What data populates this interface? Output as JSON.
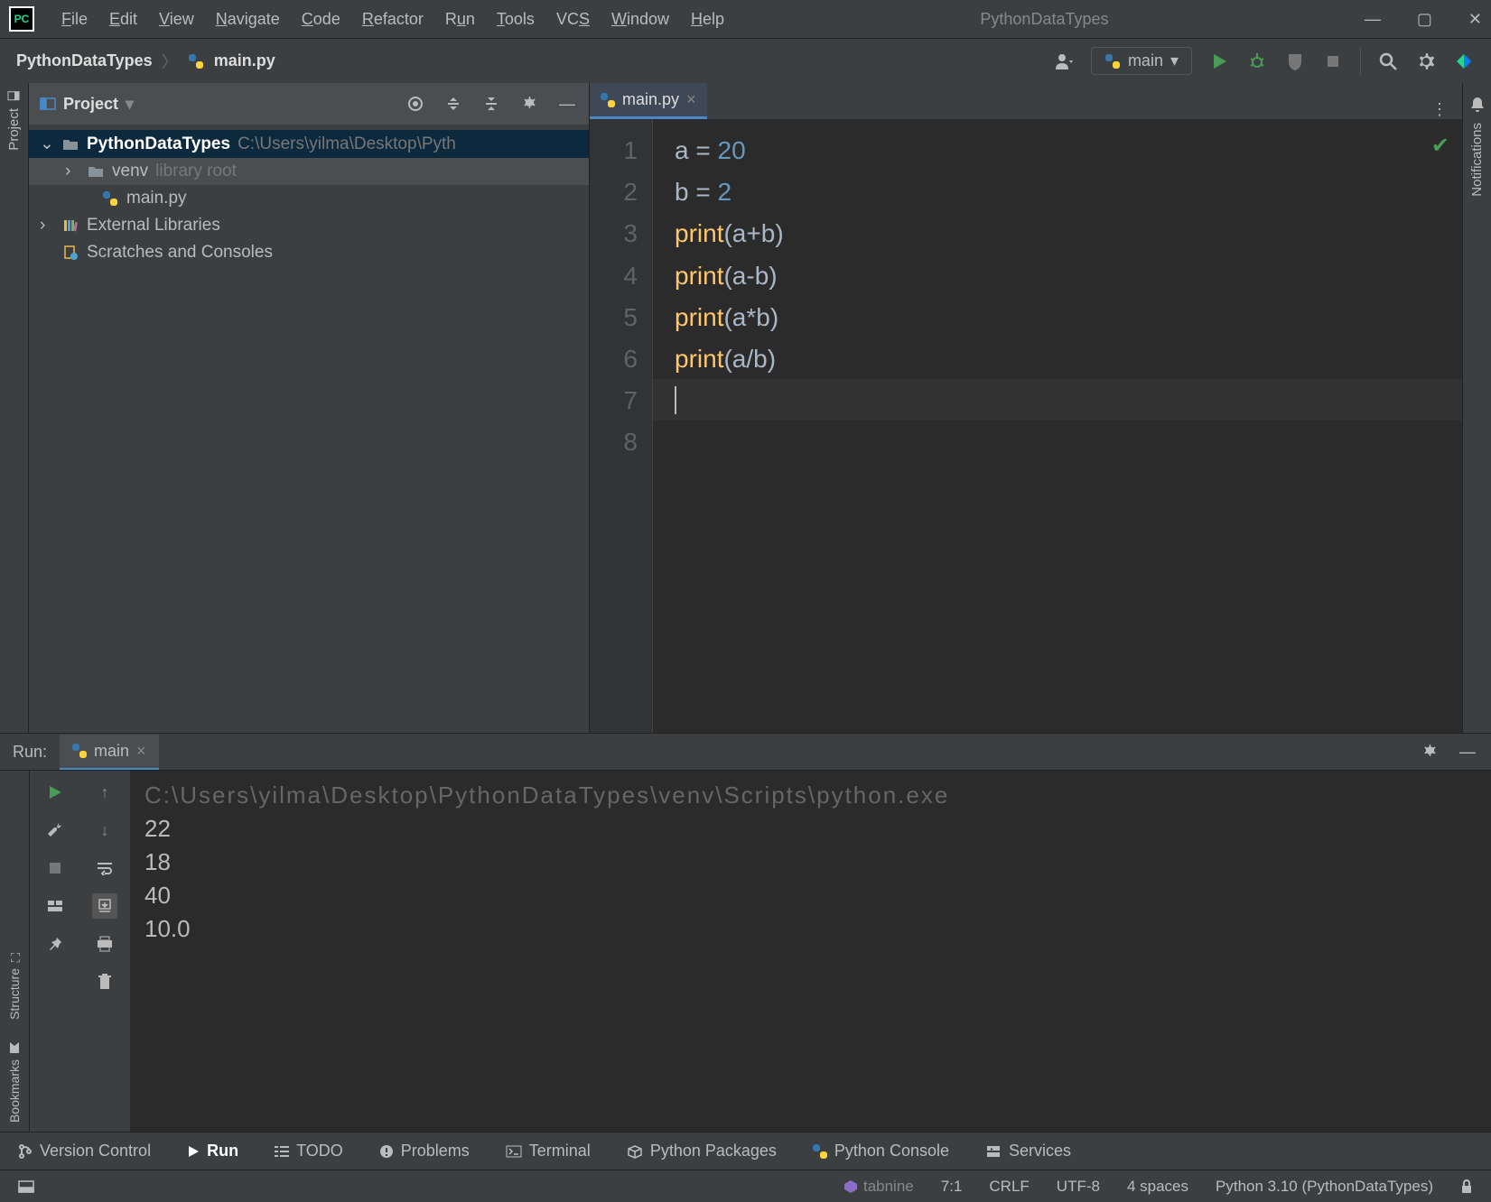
{
  "title": "PythonDataTypes",
  "menu": [
    "File",
    "Edit",
    "View",
    "Navigate",
    "Code",
    "Refactor",
    "Run",
    "Tools",
    "VCS",
    "Window",
    "Help"
  ],
  "breadcrumb": {
    "project": "PythonDataTypes",
    "file": "main.py"
  },
  "runConfig": "main",
  "project": {
    "panelLabel": "Project",
    "root": {
      "name": "PythonDataTypes",
      "path": "C:\\Users\\yilma\\Desktop\\Pyth"
    },
    "venv": {
      "name": "venv",
      "tag": "library root"
    },
    "file": "main.py",
    "ext": "External Libraries",
    "scratch": "Scratches and Consoles"
  },
  "editor": {
    "tab": "main.py",
    "lines": 8,
    "code": [
      {
        "type": "assign",
        "var": "a",
        "val": "20"
      },
      {
        "type": "assign",
        "var": "b",
        "val": "2"
      },
      {
        "type": "print",
        "expr": "a+b"
      },
      {
        "type": "print",
        "expr": "a-b"
      },
      {
        "type": "print",
        "expr": "a*b"
      },
      {
        "type": "print",
        "expr": "a/b"
      },
      {
        "type": "blank"
      },
      {
        "type": "blank"
      }
    ]
  },
  "run": {
    "label": "Run:",
    "tab": "main",
    "path": "C:\\Users\\yilma\\Desktop\\PythonDataTypes\\venv\\Scripts\\python.exe",
    "output": [
      "22",
      "18",
      "40",
      "10.0"
    ]
  },
  "leftPanels": [
    "Project"
  ],
  "leftPanelsBottom": [
    "Structure",
    "Bookmarks"
  ],
  "rightPanel": "Notifications",
  "bottomTabs": [
    "Version Control",
    "Run",
    "TODO",
    "Problems",
    "Terminal",
    "Python Packages",
    "Python Console",
    "Services"
  ],
  "status": {
    "tabnine": "tabnine",
    "pos": "7:1",
    "eol": "CRLF",
    "enc": "UTF-8",
    "indent": "4 spaces",
    "interp": "Python 3.10 (PythonDataTypes)"
  }
}
